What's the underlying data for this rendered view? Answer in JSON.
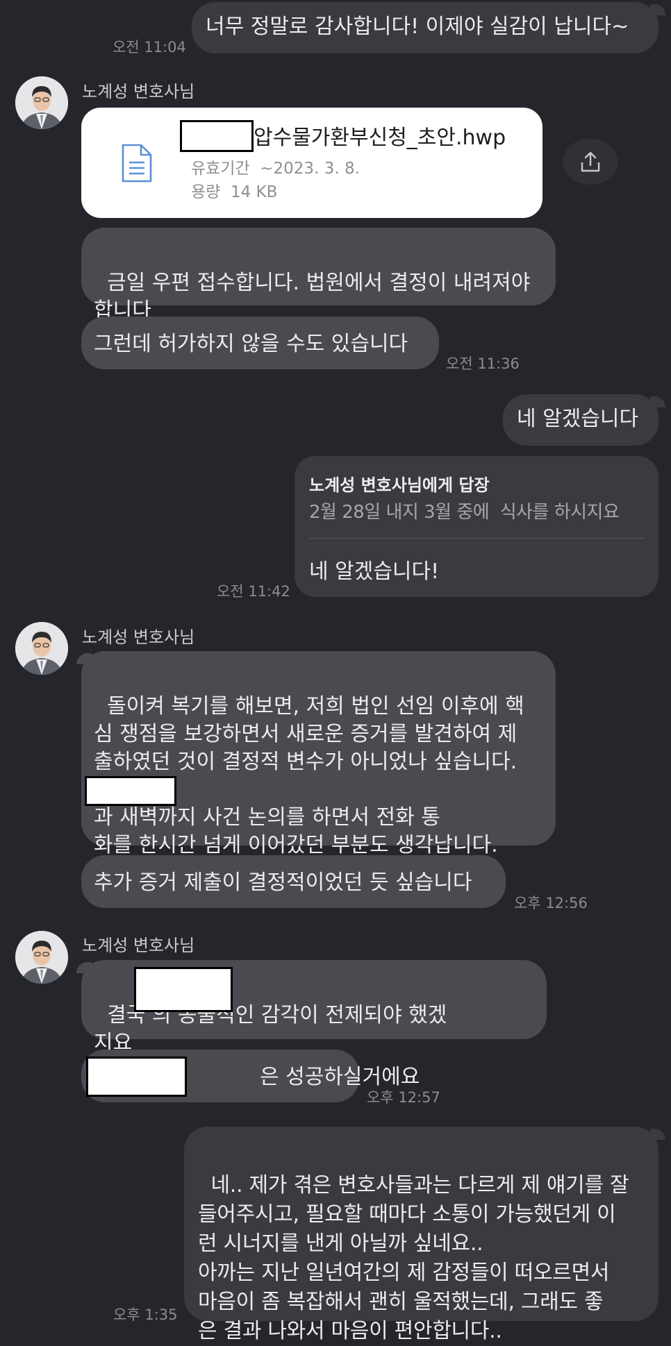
{
  "messages": {
    "m1": {
      "text": "너무 정말로 감사합니다! 이제야 실감이 납니다~",
      "time": "오전 11:04"
    },
    "sender1": "노계성 변호사님",
    "file": {
      "name": "압수물가환부신청_초안.hwp",
      "expiry_label": "유효기간",
      "expiry_value": "~2023. 3. 8.",
      "size_label": "용량",
      "size_value": "14 KB",
      "icon": "document-icon",
      "share_icon": "share-icon"
    },
    "m2": {
      "text": "금일 우편 접수합니다. 법원에서 결정이 내려져야\n합니다"
    },
    "m3": {
      "text": "그런데 허가하지 않을 수도 있습니다",
      "time": "오전 11:36"
    },
    "m4": {
      "text": "네 알겠습니다"
    },
    "reply": {
      "header": "노계성 변호사님에게 답장",
      "quote": "2월 28일 내지 3월 중에  식사를 하시지요",
      "text": "네 알겠습니다!",
      "time": "오전 11:42"
    },
    "sender2": "노계성 변호사님",
    "m5": {
      "text": "돌이켜 복기를 해보면, 저희 법인 선임 이후에 핵\n심 쟁점을 보강하면서 새로운 증거를 발견하여 제\n출하였던 것이 결정적 변수가 아니었나 싶습니다.\n\n과 새벽까지 사건 논의를 하면서 전화 통\n화를 한시간 넘게 이어갔던 부분도 생각납니다."
    },
    "m6": {
      "text": "추가 증거 제출이 결정적이었던 듯 싶습니다",
      "time": "오후 12:56"
    },
    "sender3": "노계성 변호사님",
    "m7": {
      "text": "결국 의 동물적인 감각이 전제되야 했겠\n지요"
    },
    "m8": {
      "text": "은 성공하실거에요",
      "time": "오후 12:57"
    },
    "m9": {
      "text": "네.. 제가 겪은 변호사들과는 다르게 제 얘기를 잘\n들어주시고, 필요할 때마다 소통이 가능했던게 이\n런 시너지를 낸게 아닐까 싶네요..\n아까는 지난 일년여간의 제 감정들이 떠오르면서\n마음이 좀 복잡해서 괜히 울적했는데, 그래도 좋\n은 결과 나와서 마음이 편안합니다..",
      "time": "오후 1:35"
    }
  },
  "colors": {
    "background": "#25262b",
    "my_bubble": "#3a3b40",
    "their_bubble": "#4a4b51",
    "file_card": "#ffffff"
  }
}
